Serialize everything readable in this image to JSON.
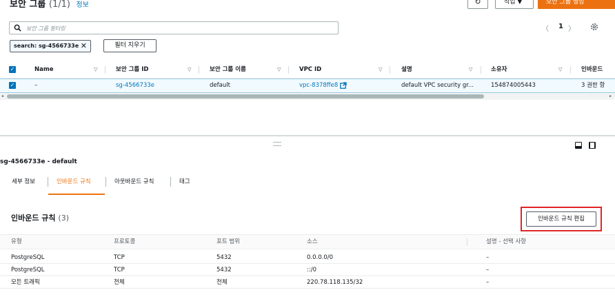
{
  "header": {
    "title": "보안 그룹",
    "count": "(1/1)",
    "info_link": "정보",
    "actions_label": "작업 ▼",
    "create_label": "보안 그룹 생성"
  },
  "filter": {
    "placeholder": "보안 그룹 필터링",
    "token": "search: sg-4566733e",
    "clear_label": "필터 지우기"
  },
  "pagination": {
    "prev": "〈",
    "page": "1",
    "next": "〉"
  },
  "table": {
    "columns": [
      "Name",
      "보안 그룹 ID",
      "보안 그룹 이름",
      "VPC ID",
      "설명",
      "소유자",
      "인바운드"
    ],
    "row": {
      "name": "–",
      "sg_id": "sg-4566733e",
      "sg_name": "default",
      "vpc_id": "vpc-8378ffe8",
      "description": "default VPC security gr...",
      "owner": "154874005443",
      "inbound": "3 권한 항"
    }
  },
  "detail": {
    "title": "sg-4566733e - default",
    "tabs": [
      "세부 정보",
      "인바운드 규칙",
      "아웃바운드 규칙",
      "태그"
    ],
    "active_tab": 1,
    "rules_title": "인바운드 규칙",
    "rules_count": "(3)",
    "edit_label": "인바운드 규칙 편집",
    "rules_columns": [
      "유형",
      "프로토콜",
      "포트 범위",
      "소스",
      "설명 - 선택 사항"
    ],
    "rules": [
      {
        "type": "PostgreSQL",
        "protocol": "TCP",
        "port": "5432",
        "source": "0.0.0.0/0",
        "desc": "–"
      },
      {
        "type": "PostgreSQL",
        "protocol": "TCP",
        "port": "5432",
        "source": "::/0",
        "desc": "–"
      },
      {
        "type": "모든 트래픽",
        "protocol": "전체",
        "port": "전체",
        "source": "220.78.118.135/32",
        "desc": "–"
      }
    ]
  },
  "colors": {
    "accent": "#ec7211",
    "link": "#0073bb",
    "highlight": "#e02424"
  }
}
